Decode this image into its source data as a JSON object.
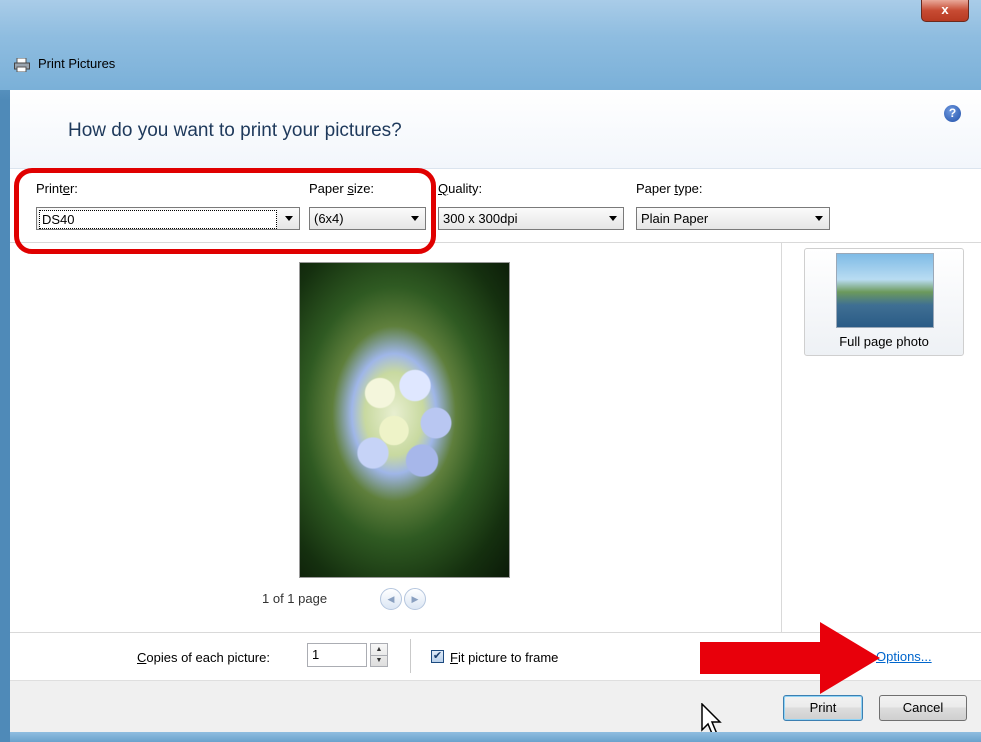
{
  "window": {
    "title": "Print Pictures",
    "close_label": "x"
  },
  "header": {
    "question": "How do you want to print your pictures?"
  },
  "settings": {
    "printer": {
      "label_pre": "Print",
      "label_key": "e",
      "label_post": "r:",
      "value": "DS40"
    },
    "paper_size": {
      "label_pre": "Paper ",
      "label_key": "s",
      "label_post": "ize:",
      "value": "(6x4)"
    },
    "quality": {
      "label_pre": "",
      "label_key": "Q",
      "label_post": "uality:",
      "value": "300 x 300dpi"
    },
    "paper_type": {
      "label_pre": "Paper ",
      "label_key": "t",
      "label_post": "ype:",
      "value": "Plain Paper"
    },
    "help_label": "?"
  },
  "preview": {
    "page_indicator": "1 of 1 page",
    "prev_glyph": "◀",
    "next_glyph": "▶"
  },
  "layouts": {
    "items": [
      {
        "label": "Full page photo"
      }
    ]
  },
  "bottom": {
    "copies_key": "C",
    "copies_rest": "opies of each picture:",
    "copies_value": "1",
    "spin_up": "▲",
    "spin_down": "▼",
    "fit_checked_glyph": "✔",
    "fit_key": "F",
    "fit_rest": "it picture to frame",
    "options_label": "Options..."
  },
  "footer": {
    "print_label": "Print",
    "cancel_label": "Cancel"
  },
  "colors": {
    "highlight": "#e00000",
    "link": "#0066cc",
    "question": "#1e395b"
  }
}
